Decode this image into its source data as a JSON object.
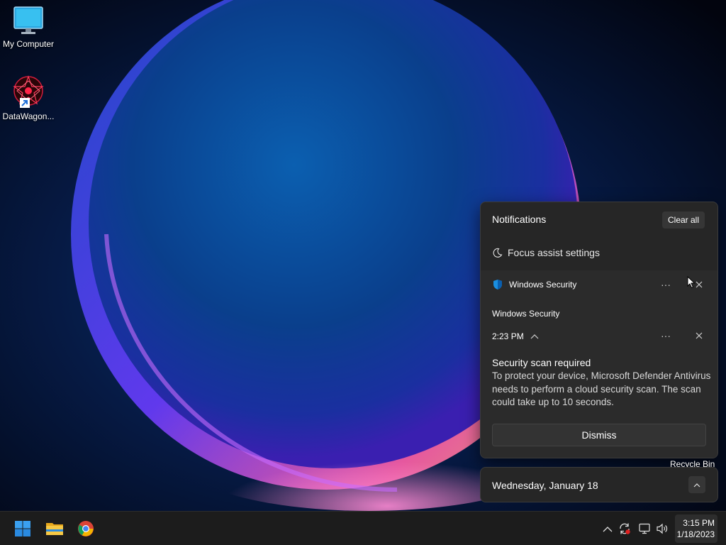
{
  "desktop": {
    "icons": [
      {
        "label": "My Computer",
        "icon": "monitor-icon"
      },
      {
        "label": "DataWagon...",
        "icon": "datawagon-icon"
      }
    ],
    "recycle_bin_label": "Recycle Bin"
  },
  "notifications": {
    "title": "Notifications",
    "clear_all_label": "Clear all",
    "focus_assist_label": "Focus assist settings",
    "toast": {
      "app_name": "Windows Security",
      "app_icon": "shield-icon",
      "source": "Windows Security",
      "time": "2:23 PM",
      "more_label": "···",
      "heading": "Security scan required",
      "body": "To protect your device, Microsoft Defender Antivirus needs to perform a cloud security scan. The scan could take up to 10 seconds.",
      "dismiss_label": "Dismiss"
    }
  },
  "calendar": {
    "date_label": "Wednesday, January 18"
  },
  "taskbar": {
    "apps": [
      "start-icon",
      "file-explorer-icon",
      "chrome-icon"
    ],
    "tray_icons": [
      "chevron-up-icon",
      "sync-icon",
      "network-icon",
      "volume-icon"
    ],
    "clock": {
      "time": "3:15 PM",
      "date": "1/18/2023"
    }
  },
  "colors": {
    "panel_bg": "#262626",
    "toast_bg": "#2b2b2b",
    "taskbar_bg": "#1c1c1c",
    "accent_blue": "#0078d4"
  }
}
